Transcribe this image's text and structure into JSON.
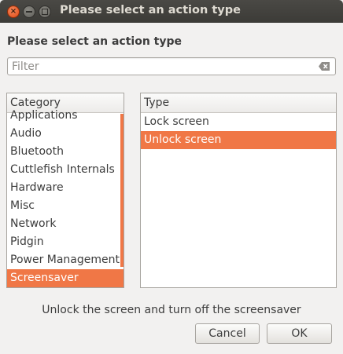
{
  "window": {
    "title": "Please select an action type",
    "close_glyph": "×"
  },
  "dialog": {
    "heading": "Please select an action type",
    "filter": {
      "value": "",
      "placeholder": "Filter",
      "clear_icon": "clear-entry-icon"
    },
    "category": {
      "header": "Category",
      "items": [
        "Applications",
        "Audio",
        "Bluetooth",
        "Cuttlefish Internals",
        "Hardware",
        "Misc",
        "Network",
        "Pidgin",
        "Power Management",
        "Screensaver"
      ],
      "selected": "Screensaver"
    },
    "type": {
      "header": "Type",
      "items": [
        "Lock screen",
        "Unlock screen"
      ],
      "selected": "Unlock screen"
    },
    "description": "Unlock the screen and turn off the screensaver",
    "buttons": {
      "cancel": "Cancel",
      "ok": "OK"
    }
  },
  "colors": {
    "selection": "#f07746",
    "titlebar": "#3c3b37",
    "background": "#f2f1f0"
  }
}
